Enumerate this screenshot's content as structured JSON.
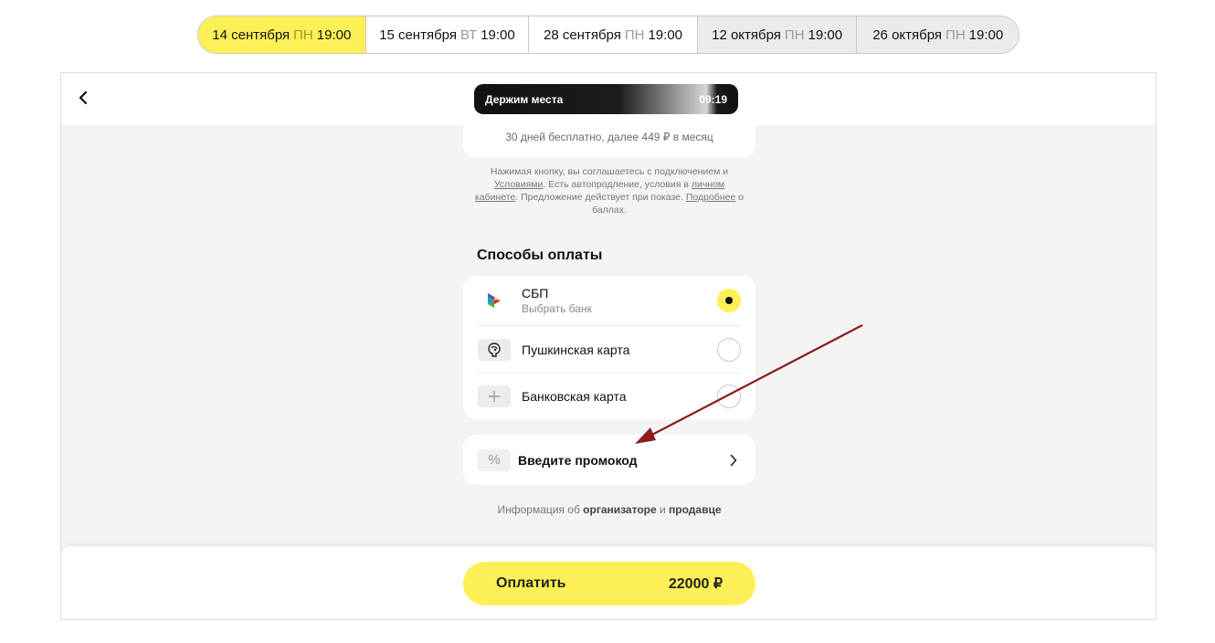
{
  "date_tabs": [
    {
      "date": "14 сентября",
      "dow": "ПН",
      "time": "19:00",
      "state": "active"
    },
    {
      "date": "15 сентября",
      "dow": "ВТ",
      "time": "19:00",
      "state": "normal"
    },
    {
      "date": "28 сентября",
      "dow": "ПН",
      "time": "19:00",
      "state": "normal"
    },
    {
      "date": "12 октября",
      "dow": "ПН",
      "time": "19:00",
      "state": "muted"
    },
    {
      "date": "26 октября",
      "dow": "ПН",
      "time": "19:00",
      "state": "muted"
    }
  ],
  "header": {
    "timer_label": "Держим места",
    "timer_value": "09:19"
  },
  "subscription": {
    "note": "30 дней бесплатно, далее 449 ₽ в месяц"
  },
  "legal": {
    "part1": "Нажимая кнопку, вы соглашаетесь с подключением и ",
    "link_terms": "Условиями",
    "part2": ". Есть автопродление, условия в ",
    "link_account": "личном кабинете",
    "part3": ". Предложение действует при показе. ",
    "link_more": "Подробнее",
    "part4": " о баллах."
  },
  "payment": {
    "title": "Способы оплаты",
    "methods": [
      {
        "label": "СБП",
        "sub": "Выбрать банк",
        "icon": "sbp-icon",
        "selected": true
      },
      {
        "label": "Пушкинская карта",
        "sub": "",
        "icon": "pushkin-card-icon",
        "selected": false
      },
      {
        "label": "Банковская карта",
        "sub": "",
        "icon": "plus-icon",
        "selected": false
      }
    ]
  },
  "promo": {
    "icon": "percent-icon",
    "icon_glyph": "%",
    "label": "Введите промокод"
  },
  "info": {
    "prefix": "Информация об ",
    "organizer": "организаторе",
    "and": " и ",
    "seller": "продавце"
  },
  "footer": {
    "pay_label": "Оплатить",
    "amount": "22000 ₽"
  },
  "colors": {
    "accent_yellow": "#fdf056",
    "annotation_arrow": "#8b1c1c"
  }
}
